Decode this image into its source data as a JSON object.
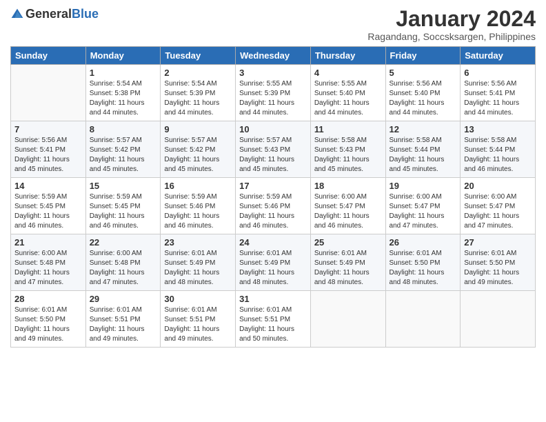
{
  "logo": {
    "general": "General",
    "blue": "Blue"
  },
  "header": {
    "month": "January 2024",
    "location": "Ragandang, Soccsksargen, Philippines"
  },
  "days_of_week": [
    "Sunday",
    "Monday",
    "Tuesday",
    "Wednesday",
    "Thursday",
    "Friday",
    "Saturday"
  ],
  "weeks": [
    [
      {
        "day": "",
        "sunrise": "",
        "sunset": "",
        "daylight": ""
      },
      {
        "day": "1",
        "sunrise": "Sunrise: 5:54 AM",
        "sunset": "Sunset: 5:38 PM",
        "daylight": "Daylight: 11 hours and 44 minutes."
      },
      {
        "day": "2",
        "sunrise": "Sunrise: 5:54 AM",
        "sunset": "Sunset: 5:39 PM",
        "daylight": "Daylight: 11 hours and 44 minutes."
      },
      {
        "day": "3",
        "sunrise": "Sunrise: 5:55 AM",
        "sunset": "Sunset: 5:39 PM",
        "daylight": "Daylight: 11 hours and 44 minutes."
      },
      {
        "day": "4",
        "sunrise": "Sunrise: 5:55 AM",
        "sunset": "Sunset: 5:40 PM",
        "daylight": "Daylight: 11 hours and 44 minutes."
      },
      {
        "day": "5",
        "sunrise": "Sunrise: 5:56 AM",
        "sunset": "Sunset: 5:40 PM",
        "daylight": "Daylight: 11 hours and 44 minutes."
      },
      {
        "day": "6",
        "sunrise": "Sunrise: 5:56 AM",
        "sunset": "Sunset: 5:41 PM",
        "daylight": "Daylight: 11 hours and 44 minutes."
      }
    ],
    [
      {
        "day": "7",
        "sunrise": "Sunrise: 5:56 AM",
        "sunset": "Sunset: 5:41 PM",
        "daylight": "Daylight: 11 hours and 45 minutes."
      },
      {
        "day": "8",
        "sunrise": "Sunrise: 5:57 AM",
        "sunset": "Sunset: 5:42 PM",
        "daylight": "Daylight: 11 hours and 45 minutes."
      },
      {
        "day": "9",
        "sunrise": "Sunrise: 5:57 AM",
        "sunset": "Sunset: 5:42 PM",
        "daylight": "Daylight: 11 hours and 45 minutes."
      },
      {
        "day": "10",
        "sunrise": "Sunrise: 5:57 AM",
        "sunset": "Sunset: 5:43 PM",
        "daylight": "Daylight: 11 hours and 45 minutes."
      },
      {
        "day": "11",
        "sunrise": "Sunrise: 5:58 AM",
        "sunset": "Sunset: 5:43 PM",
        "daylight": "Daylight: 11 hours and 45 minutes."
      },
      {
        "day": "12",
        "sunrise": "Sunrise: 5:58 AM",
        "sunset": "Sunset: 5:44 PM",
        "daylight": "Daylight: 11 hours and 45 minutes."
      },
      {
        "day": "13",
        "sunrise": "Sunrise: 5:58 AM",
        "sunset": "Sunset: 5:44 PM",
        "daylight": "Daylight: 11 hours and 46 minutes."
      }
    ],
    [
      {
        "day": "14",
        "sunrise": "Sunrise: 5:59 AM",
        "sunset": "Sunset: 5:45 PM",
        "daylight": "Daylight: 11 hours and 46 minutes."
      },
      {
        "day": "15",
        "sunrise": "Sunrise: 5:59 AM",
        "sunset": "Sunset: 5:45 PM",
        "daylight": "Daylight: 11 hours and 46 minutes."
      },
      {
        "day": "16",
        "sunrise": "Sunrise: 5:59 AM",
        "sunset": "Sunset: 5:46 PM",
        "daylight": "Daylight: 11 hours and 46 minutes."
      },
      {
        "day": "17",
        "sunrise": "Sunrise: 5:59 AM",
        "sunset": "Sunset: 5:46 PM",
        "daylight": "Daylight: 11 hours and 46 minutes."
      },
      {
        "day": "18",
        "sunrise": "Sunrise: 6:00 AM",
        "sunset": "Sunset: 5:47 PM",
        "daylight": "Daylight: 11 hours and 46 minutes."
      },
      {
        "day": "19",
        "sunrise": "Sunrise: 6:00 AM",
        "sunset": "Sunset: 5:47 PM",
        "daylight": "Daylight: 11 hours and 47 minutes."
      },
      {
        "day": "20",
        "sunrise": "Sunrise: 6:00 AM",
        "sunset": "Sunset: 5:47 PM",
        "daylight": "Daylight: 11 hours and 47 minutes."
      }
    ],
    [
      {
        "day": "21",
        "sunrise": "Sunrise: 6:00 AM",
        "sunset": "Sunset: 5:48 PM",
        "daylight": "Daylight: 11 hours and 47 minutes."
      },
      {
        "day": "22",
        "sunrise": "Sunrise: 6:00 AM",
        "sunset": "Sunset: 5:48 PM",
        "daylight": "Daylight: 11 hours and 47 minutes."
      },
      {
        "day": "23",
        "sunrise": "Sunrise: 6:01 AM",
        "sunset": "Sunset: 5:49 PM",
        "daylight": "Daylight: 11 hours and 48 minutes."
      },
      {
        "day": "24",
        "sunrise": "Sunrise: 6:01 AM",
        "sunset": "Sunset: 5:49 PM",
        "daylight": "Daylight: 11 hours and 48 minutes."
      },
      {
        "day": "25",
        "sunrise": "Sunrise: 6:01 AM",
        "sunset": "Sunset: 5:49 PM",
        "daylight": "Daylight: 11 hours and 48 minutes."
      },
      {
        "day": "26",
        "sunrise": "Sunrise: 6:01 AM",
        "sunset": "Sunset: 5:50 PM",
        "daylight": "Daylight: 11 hours and 48 minutes."
      },
      {
        "day": "27",
        "sunrise": "Sunrise: 6:01 AM",
        "sunset": "Sunset: 5:50 PM",
        "daylight": "Daylight: 11 hours and 49 minutes."
      }
    ],
    [
      {
        "day": "28",
        "sunrise": "Sunrise: 6:01 AM",
        "sunset": "Sunset: 5:50 PM",
        "daylight": "Daylight: 11 hours and 49 minutes."
      },
      {
        "day": "29",
        "sunrise": "Sunrise: 6:01 AM",
        "sunset": "Sunset: 5:51 PM",
        "daylight": "Daylight: 11 hours and 49 minutes."
      },
      {
        "day": "30",
        "sunrise": "Sunrise: 6:01 AM",
        "sunset": "Sunset: 5:51 PM",
        "daylight": "Daylight: 11 hours and 49 minutes."
      },
      {
        "day": "31",
        "sunrise": "Sunrise: 6:01 AM",
        "sunset": "Sunset: 5:51 PM",
        "daylight": "Daylight: 11 hours and 50 minutes."
      },
      {
        "day": "",
        "sunrise": "",
        "sunset": "",
        "daylight": ""
      },
      {
        "day": "",
        "sunrise": "",
        "sunset": "",
        "daylight": ""
      },
      {
        "day": "",
        "sunrise": "",
        "sunset": "",
        "daylight": ""
      }
    ]
  ]
}
